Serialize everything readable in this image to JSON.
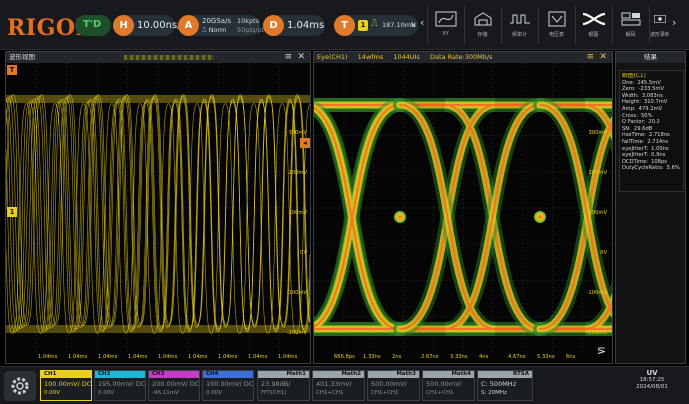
{
  "colors": {
    "accent_orange": "#e36f21",
    "ch1_yellow": "#e9d01f",
    "ch2_cyan": "#20b7d6",
    "ch3_magenta": "#c43cc4",
    "ch4_blue": "#3a6fd8",
    "trigger_green": "#34b24b",
    "math_orange": "#e07a2a",
    "ref_gray": "#9aa4ad"
  },
  "topbar": {
    "logo": "RIGOL",
    "run_status": "T'D",
    "horizontal": {
      "badge": "H",
      "timebase": "10.00ns/"
    },
    "acquire": {
      "badge": "A",
      "sample_rate": "20GSa/s",
      "mode": "Norm",
      "mem_depth": "10kpts",
      "points": "50pts/pt"
    },
    "delay": {
      "badge": "D",
      "value": "1.04ms"
    },
    "trigger": {
      "badge": "T",
      "source": "1",
      "level": "187.10mV",
      "slope": "N"
    },
    "toolbar_buttons": [
      {
        "label": "XY",
        "icon": "xy-icon"
      },
      {
        "label": "存储",
        "icon": "save-icon"
      },
      {
        "label": "频率计",
        "icon": "counter-icon"
      },
      {
        "label": "电压表",
        "icon": "voltmeter-icon"
      },
      {
        "label": "眼图",
        "icon": "eye-diagram-icon"
      },
      {
        "label": "解码",
        "icon": "decode-icon"
      },
      {
        "label": "波形录制",
        "icon": "record-icon"
      }
    ]
  },
  "waveform_panel": {
    "title": "波形视图",
    "time_ticks": [
      "1.04ms",
      "1.04ms",
      "1.04ms",
      "1.04ms",
      "1.04ms",
      "1.04ms",
      "1.04ms",
      "1.04ms",
      "1.04ms"
    ],
    "volt_ticks": [
      "300mV",
      "200mV",
      "100mV",
      "0V",
      "-100mV",
      "-200mV"
    ],
    "channel_marker": "1",
    "trigger_marker": "T"
  },
  "eye_panel": {
    "source": "Eye(CH1)",
    "rate": "14wfms",
    "count": "1044UIs",
    "data_rate": "Data Rate:300Mb/s",
    "volt_ticks": [
      "300mV",
      "200mV",
      "100mV",
      "0V",
      "-100mV",
      "-200mV"
    ],
    "time_ticks": [
      "666.8ps",
      "1.33ns",
      "2ns",
      "2.67ns",
      "3.33ns",
      "4ns",
      "4.67ns",
      "5.33ns",
      "6ns"
    ]
  },
  "measure_panel": {
    "title": "结果",
    "heading": "眼图(C1)",
    "rows": [
      {
        "label": "One:",
        "value": "245.5mV"
      },
      {
        "label": "Zero:",
        "value": "-233.5mV"
      },
      {
        "label": "Width:",
        "value": "3.083ns"
      },
      {
        "label": "Height:",
        "value": "310.7mV"
      },
      {
        "label": "Amp:",
        "value": "479.2mV"
      },
      {
        "label": "Cross:",
        "value": "50%"
      },
      {
        "label": "Q Factor:",
        "value": "20.2"
      },
      {
        "label": "SN:",
        "value": "29.6dB"
      },
      {
        "label": "riseTime:",
        "value": "2.718ns"
      },
      {
        "label": "fallTime:",
        "value": "2.714ns"
      },
      {
        "label": "eyeJitterT:",
        "value": "1.00ns"
      },
      {
        "label": "eyeJitterT:",
        "value": "0.9ns"
      },
      {
        "label": "DCDTime:",
        "value": "108ps"
      },
      {
        "label": "DutyCycleRatio:",
        "value": "5.6%"
      }
    ]
  },
  "bottombar": {
    "channels": [
      {
        "name": "CH1",
        "scale": "100.00mV/",
        "coupling": "DC",
        "offset": "0.00V",
        "active": true
      },
      {
        "name": "CH2",
        "scale": "195.00mV/",
        "coupling": "DC",
        "offset": "0.00V",
        "active": false
      },
      {
        "name": "CH3",
        "scale": "200.00mV/",
        "coupling": "DC",
        "offset": "-96.11mV",
        "active": false
      },
      {
        "name": "CH4",
        "scale": "100.00mV/",
        "coupling": "DC",
        "offset": "0.00V",
        "active": false
      }
    ],
    "math": [
      {
        "name": "Math1",
        "value": "23.98dB/",
        "sub": "FFT(CH1)"
      },
      {
        "name": "Math2",
        "value": "401.33mV/",
        "sub": "CH1+CH1"
      },
      {
        "name": "Math3",
        "value": "500.00mV/",
        "sub": "CH1+CH1"
      },
      {
        "name": "Math4",
        "value": "500.00mV/",
        "sub": "CH1+CH1"
      }
    ],
    "rs": {
      "name": "RTSA",
      "value": "C: 500MHz",
      "sub": "S: 20MHz"
    },
    "status": "UV",
    "time": "18:57:25",
    "date": "2024/08/01"
  }
}
